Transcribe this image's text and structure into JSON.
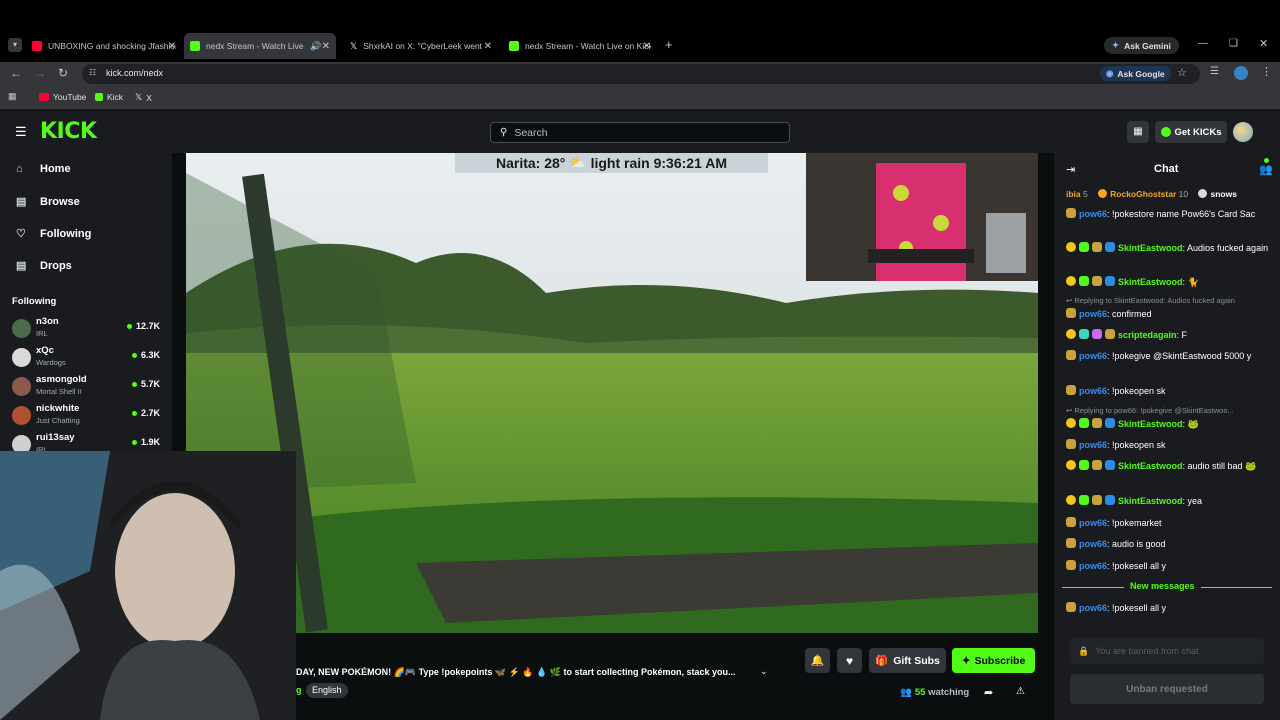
{
  "browser": {
    "tabs": [
      {
        "title": "UNBOXING and shocking Jfashion...",
        "color": "#ff0033"
      },
      {
        "title": "nedx Stream - Watch Live on Kick",
        "color": "#53fc18"
      },
      {
        "title": "ShxrkAI on X: \"CyberLeek went",
        "color": "#ffffff"
      },
      {
        "title": "nedx Stream - Watch Live on Kick",
        "color": "#53fc18"
      }
    ],
    "ask_gemini": "Ask Gemini",
    "url": "kick.com/nedx",
    "ask_google": "Ask Google",
    "bookmarks": [
      "YouTube",
      "Kick",
      "X"
    ]
  },
  "kick": {
    "logo": "KICK",
    "search_placeholder": "Search",
    "get_kicks": "Get KICKs",
    "nav": [
      {
        "label": "Home",
        "icon": "home-icon"
      },
      {
        "label": "Browse",
        "icon": "browse-icon"
      },
      {
        "label": "Following",
        "icon": "heart-icon"
      },
      {
        "label": "Drops",
        "icon": "drops-icon"
      }
    ],
    "following_title": "Following",
    "following": [
      {
        "name": "n3on",
        "category": "IRL",
        "viewers": "12.7K",
        "color": "#4b6b4a"
      },
      {
        "name": "xQc",
        "category": "Wardogs",
        "viewers": "6.3K",
        "color": "#d9d9d9"
      },
      {
        "name": "asmongold",
        "category": "Mortal Shell II",
        "viewers": "5.7K",
        "color": "#8a5a4a"
      },
      {
        "name": "nickwhite",
        "category": "Just Chatting",
        "viewers": "2.7K",
        "color": "#b05030"
      },
      {
        "name": "rui13say",
        "category": "IRL",
        "viewers": "1.9K",
        "color": "#cfcfcf"
      }
    ],
    "overlay": "Narita: 28° ⛅ light rain 9:36:21 AM",
    "stream_title": "DAY, NEW POKÉMON! 🌈🎮 Type !pokepoints 🦋 ⚡ 🔥 💧 🌿 to start collecting Pokémon, stack you...",
    "tag": "English",
    "tag_prefix": "g",
    "gift_subs": "Gift Subs",
    "subscribe": "Subscribe",
    "watching_count": "55",
    "watching_label": "watching"
  },
  "chat": {
    "title": "Chat",
    "gifters": [
      {
        "name": "ibia",
        "count": "5"
      },
      {
        "name": "RockoGhoststar",
        "count": "10"
      },
      {
        "name": "snows",
        "count": ""
      }
    ],
    "messages": [
      {
        "user": "pow66",
        "text": ": !pokestore name Pow66's Card Sac",
        "color": "#3c8ce7"
      },
      {
        "user": "SkintEastwood",
        "text": ": Audios fucked again",
        "color": "#53fc18"
      },
      {
        "user": "SkintEastwood",
        "text": ": 🐈",
        "color": "#53fc18"
      },
      {
        "reply": "Replying to SkintEastwood: Audios fucked again"
      },
      {
        "user": "pow66",
        "text": ": confirmed",
        "color": "#3c8ce7"
      },
      {
        "user": "scriptedagain",
        "text": ": F",
        "color": "#53fc18"
      },
      {
        "user": "pow66",
        "text": ": !pokegive @SkintEastwood 5000 y",
        "color": "#3c8ce7"
      },
      {
        "user": "pow66",
        "text": ": !pokeopen sk",
        "color": "#3c8ce7"
      },
      {
        "reply": "Replying to pow66: !pokegive @SkintEastwoo..."
      },
      {
        "user": "SkintEastwood",
        "text": ": 🐸",
        "color": "#53fc18"
      },
      {
        "user": "pow66",
        "text": ": !pokeopen sk",
        "color": "#3c8ce7"
      },
      {
        "user": "SkintEastwood",
        "text": ": audio still bad 🐸",
        "color": "#53fc18"
      },
      {
        "user": "SkintEastwood",
        "text": ": yea",
        "color": "#53fc18"
      },
      {
        "user": "pow66",
        "text": ": !pokemarket",
        "color": "#3c8ce7"
      },
      {
        "user": "pow66",
        "text": ": audio is good",
        "color": "#3c8ce7"
      },
      {
        "user": "pow66",
        "text": ": !pokesell all y",
        "color": "#3c8ce7"
      },
      {
        "divider": "New messages"
      },
      {
        "user": "pow66",
        "text": ": !pokesell all y",
        "color": "#3c8ce7"
      }
    ],
    "input_placeholder": "You are banned from chat",
    "unban": "Unban requested"
  }
}
